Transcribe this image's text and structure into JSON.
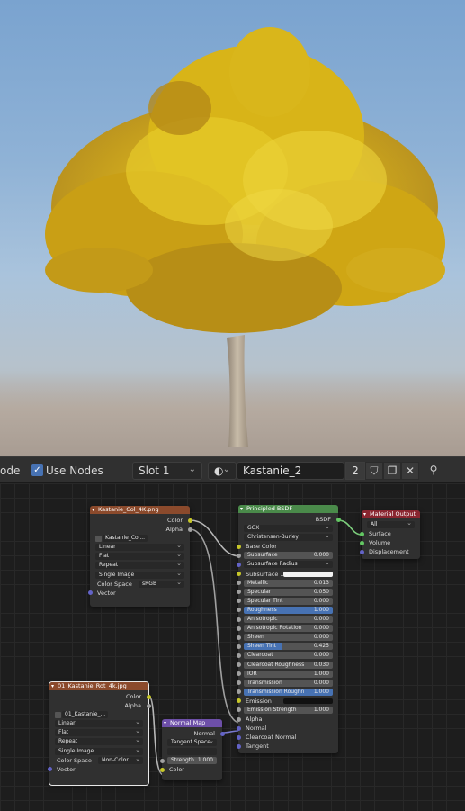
{
  "header": {
    "mode_fragment": "ode",
    "use_nodes_label": "Use Nodes",
    "use_nodes_checked": true,
    "slot": "Slot 1",
    "material_name": "Kastanie_2",
    "user_count": "2"
  },
  "nodes": {
    "col_tex": {
      "title": "Kastanie_Col_4K.png",
      "outputs": [
        "Color",
        "Alpha"
      ],
      "image_name": "Kastanie_Col...",
      "interpolation": "Linear",
      "projection": "Flat",
      "extension": "Repeat",
      "source": "Single Image",
      "color_space_label": "Color Space",
      "color_space": "sRGB",
      "input": "Vector"
    },
    "rot_tex": {
      "title": "01_Kastanie_Rot_4k.jpg",
      "outputs": [
        "Color",
        "Alpha"
      ],
      "image_name": "01_Kastanie_...",
      "interpolation": "Linear",
      "projection": "Flat",
      "extension": "Repeat",
      "source": "Single Image",
      "color_space_label": "Color Space",
      "color_space": "Non-Color",
      "input": "Vector"
    },
    "normal_map": {
      "title": "Normal Map",
      "output": "Normal",
      "space": "Tangent Space",
      "uv": "",
      "strength_label": "Strength",
      "strength": "1.000",
      "input": "Color"
    },
    "bsdf": {
      "title": "Principled BSDF",
      "output": "BSDF",
      "distribution": "GGX",
      "subsurface_method": "Christensen-Burley",
      "base_color": "Base Color",
      "subsurface_label": "Subsurface",
      "subsurface": "0.000",
      "subsurface_radius": "Subsurface Radius",
      "subsurface_color": "Subsurface ...",
      "metallic_label": "Metallic",
      "metallic": "0.013",
      "specular_label": "Specular",
      "specular": "0.050",
      "specular_tint_label": "Specular Tint",
      "specular_tint": "0.000",
      "roughness_label": "Roughness",
      "roughness": "1.000",
      "anisotropic_label": "Anisotropic",
      "anisotropic": "0.000",
      "aniso_rot_label": "Anisotropic Rotation",
      "aniso_rot": "0.000",
      "sheen_label": "Sheen",
      "sheen": "0.000",
      "sheen_tint_label": "Sheen Tint",
      "sheen_tint": "0.425",
      "clearcoat_label": "Clearcoat",
      "clearcoat": "0.000",
      "clearcoat_rough_label": "Clearcoat Roughness",
      "clearcoat_rough": "0.030",
      "ior_label": "IOR",
      "ior": "1.000",
      "transmission_label": "Transmission",
      "transmission": "0.000",
      "trans_rough_label": "Transmission Roughn",
      "trans_rough": "1.000",
      "emission": "Emission",
      "emission_strength_label": "Emission Strength",
      "emission_strength": "1.000",
      "alpha": "Alpha",
      "normal": "Normal",
      "clearcoat_normal": "Clearcoat Normal",
      "tangent": "Tangent"
    },
    "output": {
      "title": "Material Output",
      "target": "All",
      "inputs": [
        "Surface",
        "Volume",
        "Displacement"
      ]
    }
  },
  "colors": {
    "texture_header": "#8b4a2c",
    "shader_header": "#4a8a4a",
    "vector_header": "#6d4fa8",
    "output_header": "#8a2630",
    "accent": "#4772b3"
  }
}
